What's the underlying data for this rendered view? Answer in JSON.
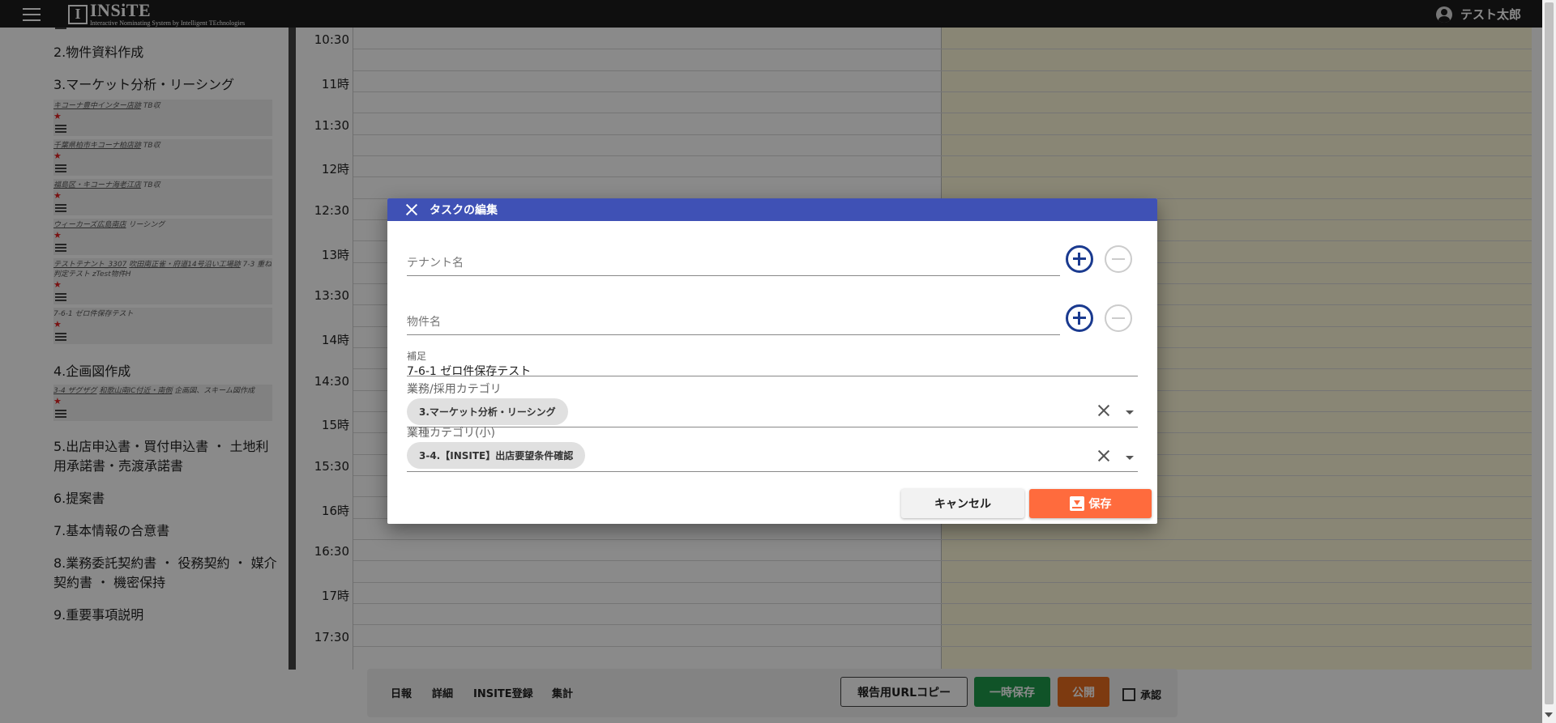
{
  "app": {
    "logo_letter": "I",
    "logo_name": "INSiTE",
    "logo_tagline": "Interactive Nominating System by Intelligent TEchnologies",
    "user_name": "テスト太郎"
  },
  "sidebar": {
    "sections": [
      {
        "label": "2.物件資料作成"
      },
      {
        "label": "3.マーケット分析・リーシング"
      },
      {
        "label": "4.企画図作成"
      },
      {
        "label": "5.出店申込書・買付申込書 ・ 土地利用承諾書・売渡承諾書"
      },
      {
        "label": "6.提案書"
      },
      {
        "label": "7.基本情報の合意書"
      },
      {
        "label": "8.業務委託契約書 ・ 役務契約 ・ 媒介契約書 ・ 機密保持"
      },
      {
        "label": "9.重要事項説明"
      }
    ],
    "tasks_section3": [
      {
        "link": "キコーナ豊中インター店跡",
        "rest": "TB収",
        "star": "★"
      },
      {
        "link": "千葉県柏市キコーナ柏店跡",
        "rest": "TB収",
        "star": "★"
      },
      {
        "link": "福島区・キコーナ海老江店",
        "rest": "TB収",
        "star": "★"
      },
      {
        "link": "ウィーカーズ広島南店",
        "rest": "リーシング",
        "star": "★"
      },
      {
        "link": "テストテナント_3307",
        "link2": "吹田南正雀・府道14号沿い工場跡",
        "rest": "7-3 重ね判定テスト zTest物件H",
        "star": "★"
      },
      {
        "link": "",
        "rest": "7-6-1 ゼロ件保存テスト",
        "star": "★"
      }
    ],
    "tasks_section4": [
      {
        "link": "3-4 ザグザグ",
        "link2": "和歌山南IC付近・南側",
        "rest": "企画図、スキーム図作成",
        "star": "★"
      }
    ]
  },
  "calendar": {
    "times": [
      "10:30",
      "11時",
      "11:30",
      "12時",
      "12:30",
      "13時",
      "13:30",
      "14時",
      "14:30",
      "15時",
      "15:30",
      "16時",
      "16:30",
      "17時",
      "17:30"
    ]
  },
  "bottombar": {
    "links": [
      "日報",
      "詳細",
      "INSITE登録",
      "集計"
    ],
    "url_copy": "報告用URLコピー",
    "temp_save": "一時保存",
    "publish": "公開",
    "approve": "承認"
  },
  "dialog": {
    "title": "タスクの編集",
    "tenant_placeholder": "テナント名",
    "property_placeholder": "物件名",
    "note_label": "補足",
    "note_value": "7-6-1 ゼロ件保存テスト",
    "category_label": "業務/採用カテゴリ",
    "category_value": "3.マーケット分析・リーシング",
    "subcategory_label": "業種カテゴリ(小)",
    "subcategory_value": "3-4.【INSITE】出店要望条件確認",
    "cancel": "キャンセル",
    "save": "保存"
  }
}
